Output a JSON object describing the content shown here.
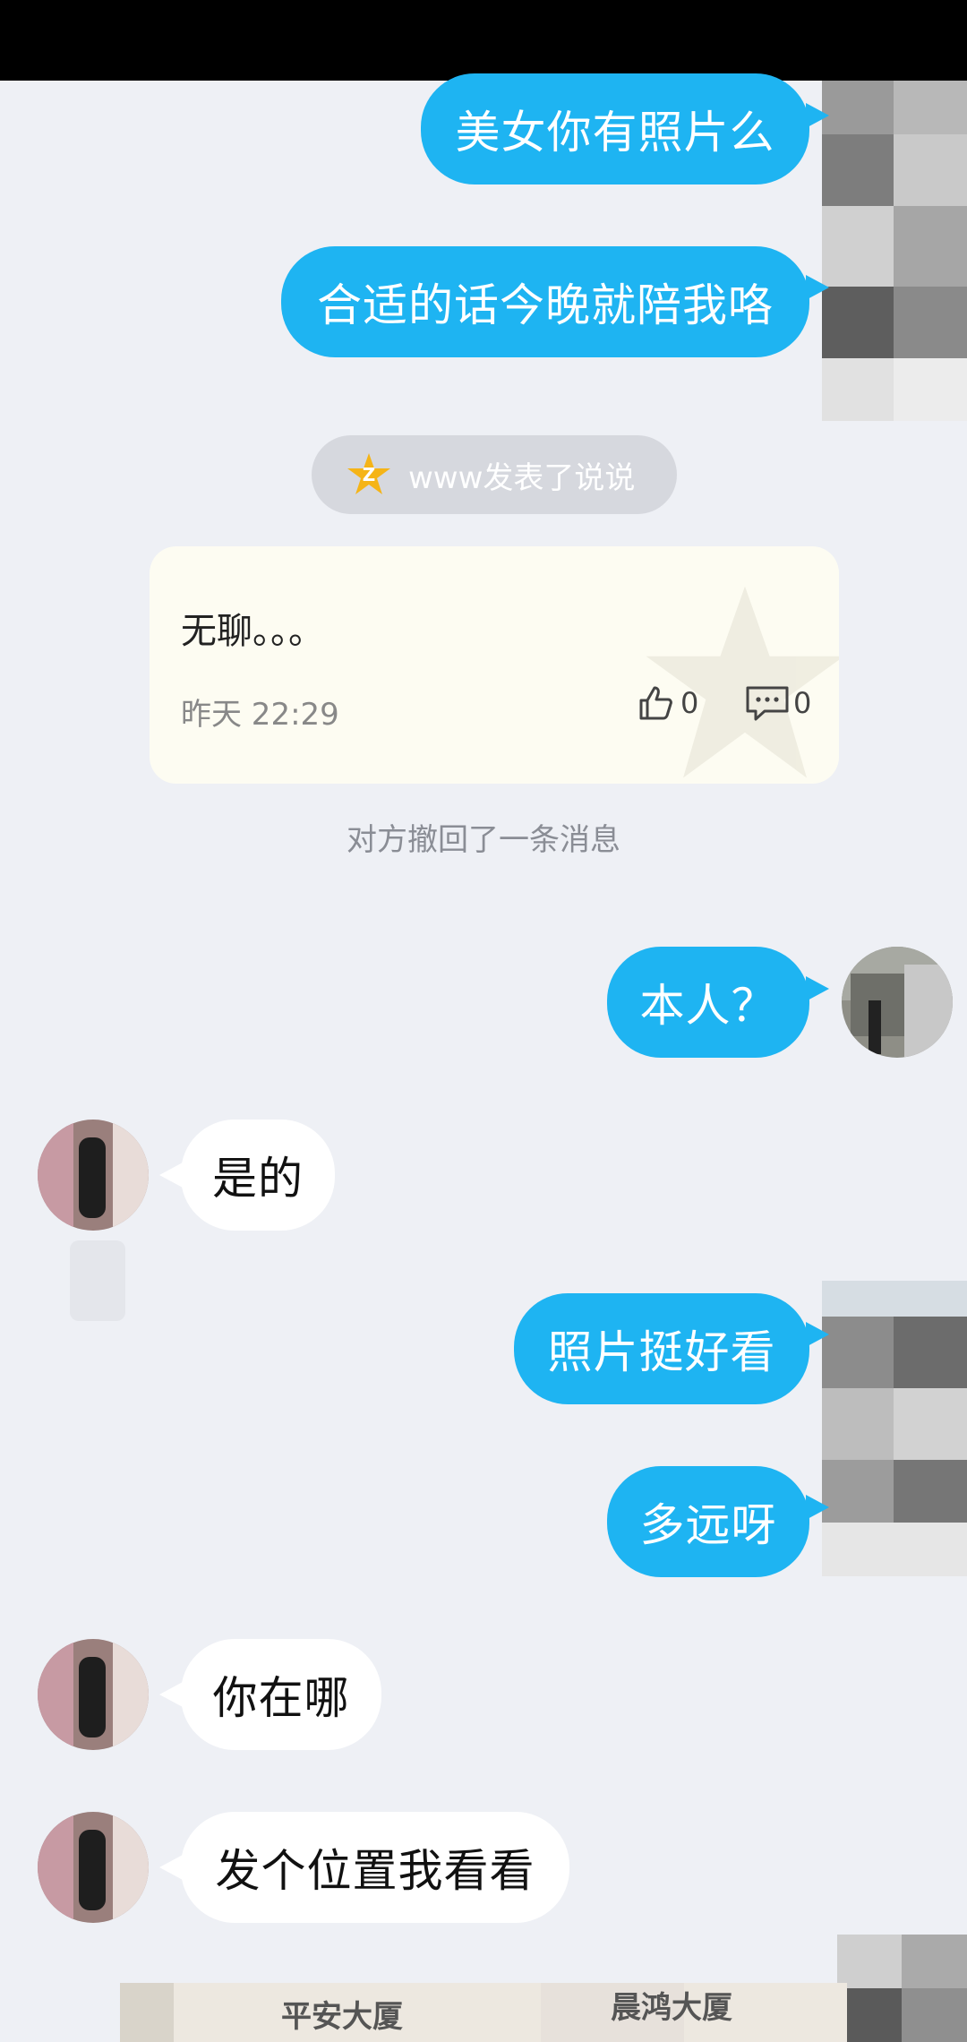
{
  "messages": {
    "m1": "美女你有照片么",
    "m2": "合适的话今晚就陪我咯",
    "m3": "本人？",
    "m4": "是的",
    "m5": "照片挺好看",
    "m6": "多远呀",
    "m7": "你在哪",
    "m8": "发个位置我看看"
  },
  "shuoshuo_notice": "www发表了说说",
  "shuoshuo_card": {
    "text": "无聊。。。",
    "time": "昨天 22:29",
    "likes": "0",
    "comments": "0"
  },
  "recall_notice": "对方撤回了一条消息",
  "map_preview": {
    "labels": [
      "平安大厦",
      "晨鸿大厦"
    ]
  },
  "colors": {
    "background": "#EEF0F5",
    "outgoing_bubble": "#1EB4F2",
    "incoming_bubble": "#FFFFFF",
    "card": "#FDFCF2"
  }
}
